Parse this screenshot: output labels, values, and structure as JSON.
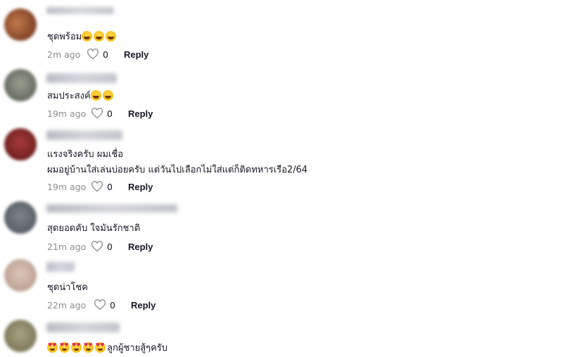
{
  "comments": [
    {
      "text": "ชุดพร้อม",
      "emoji_icons": [
        "laugh-emoji-icon",
        "laugh-emoji-icon",
        "laugh-emoji-icon"
      ],
      "time": "2m ago",
      "likes": "0",
      "reply_label": "Reply"
    },
    {
      "text": "สมประสงค์",
      "emoji_icons": [
        "laugh-emoji-icon",
        "laugh-emoji-icon"
      ],
      "time": "19m ago",
      "likes": "0",
      "reply_label": "Reply"
    },
    {
      "text_line1": "แรงจริงครับ ผมเชื่อ",
      "text_line2": "ผมอยู่บ้านใส่เล่นบ่อยครับ แต่วันไปเลือกไม่ใส่แต่ก็ติดทหารเรือ2/64",
      "time": "19m ago",
      "likes": "0",
      "reply_label": "Reply"
    },
    {
      "text": "สุดยอดคับ ใจมันรักชาติ",
      "time": "21m ago",
      "likes": "0",
      "reply_label": "Reply"
    },
    {
      "text": "ชุดน่าโชค",
      "time": "22m ago",
      "likes": "0",
      "reply_label": "Reply"
    },
    {
      "text": "ลูกผู้ชายสู้ๆครับ",
      "emoji_icons": [
        "heart-eyes-emoji-icon",
        "heart-eyes-emoji-icon",
        "heart-eyes-emoji-icon",
        "heart-eyes-emoji-icon",
        "heart-eyes-emoji-icon"
      ]
    }
  ],
  "colors": {
    "text": "#161823",
    "meta": "#8a8b91",
    "avatars": [
      "#a0563a",
      "#7d8277",
      "#8a2d2d",
      "#6a7077",
      "#c9b2a6",
      "#8f8a6a"
    ]
  }
}
